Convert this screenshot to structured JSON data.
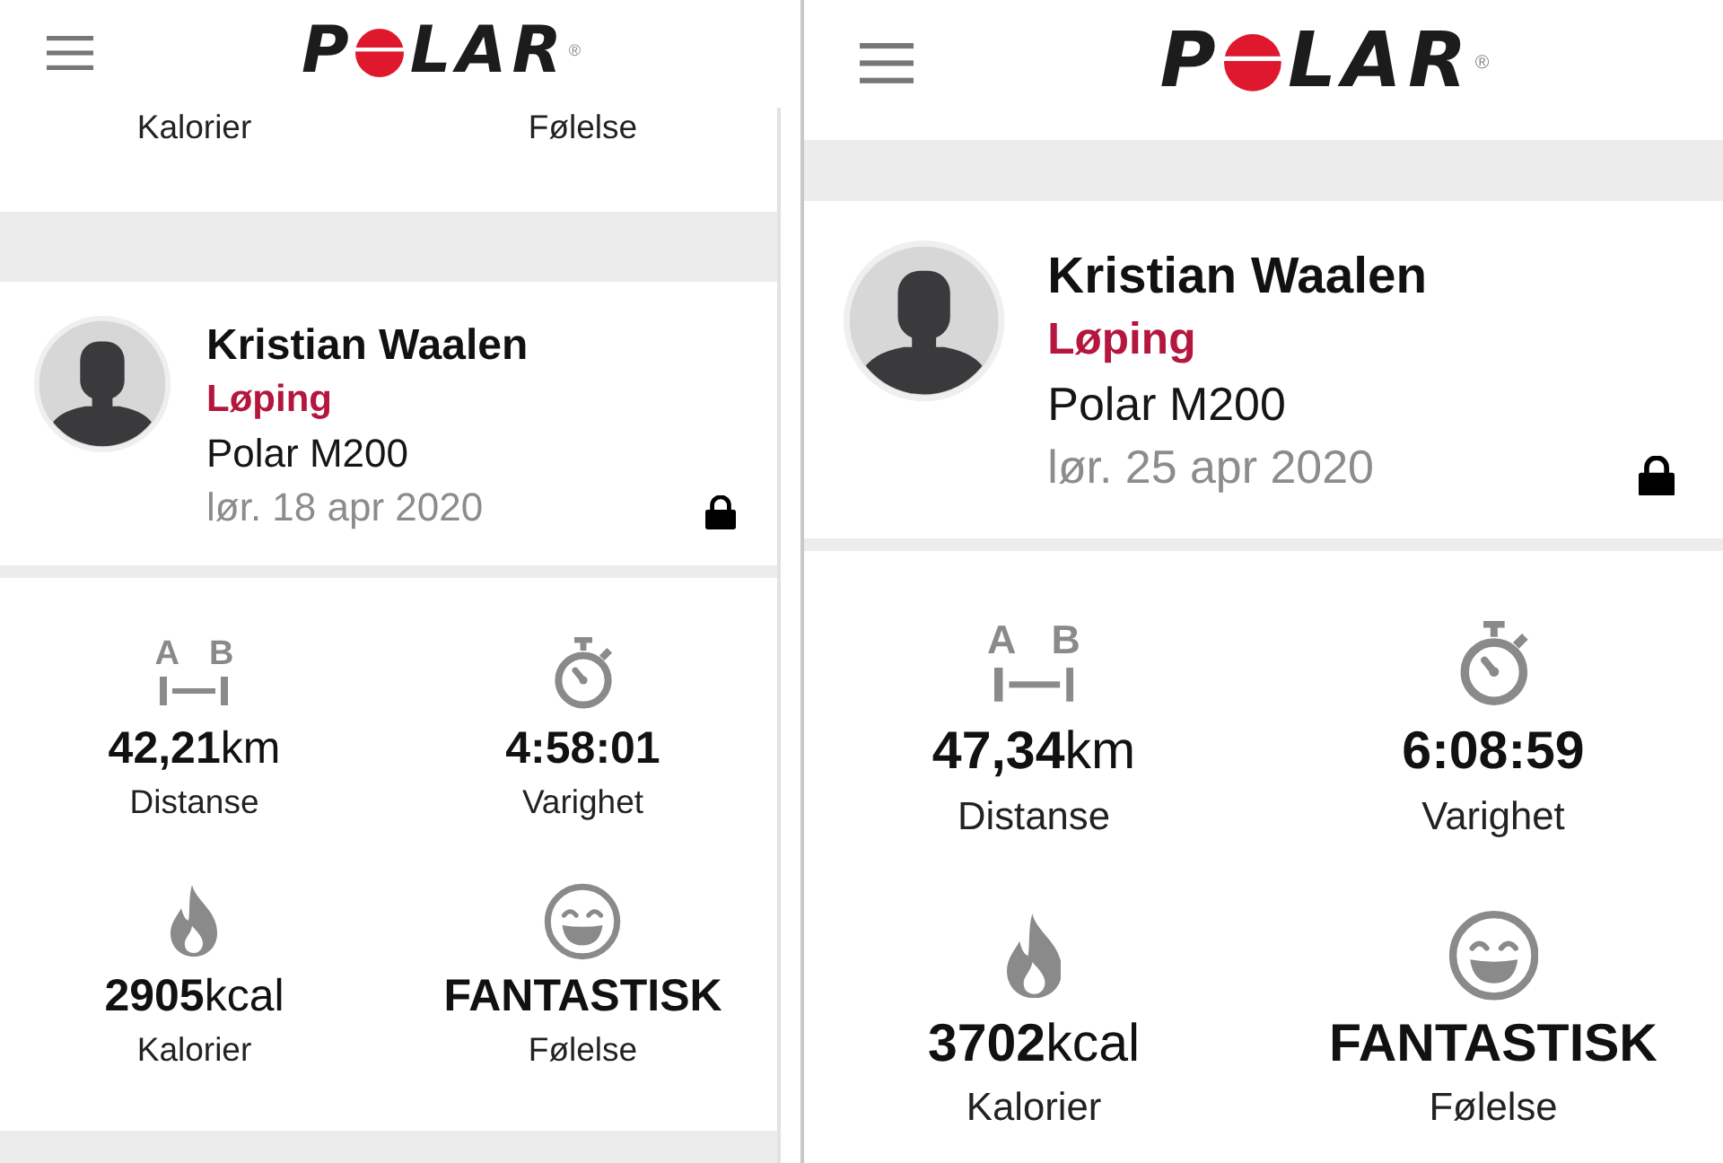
{
  "screens": [
    {
      "header": {
        "logo": {
          "start": "P",
          "end": "LAR",
          "mark": "®"
        }
      },
      "previous_card": {
        "labels": [
          "Kalorier",
          "Følelse"
        ]
      },
      "workout": {
        "name": "Kristian Waalen",
        "sport": "Løping",
        "device": "Polar M200",
        "date": "lør. 18 apr 2020"
      },
      "stats": [
        {
          "kind": "distance",
          "icon_labels": [
            "A",
            "B"
          ],
          "value": "42,21",
          "unit": "km",
          "label": "Distanse"
        },
        {
          "kind": "duration",
          "value": "4:58:01",
          "label": "Varighet"
        },
        {
          "kind": "calories",
          "value": "2905",
          "unit": "kcal",
          "label": "Kalorier"
        },
        {
          "kind": "feeling",
          "value": "FANTASTISK",
          "label": "Følelse"
        }
      ]
    },
    {
      "header": {
        "logo": {
          "start": "P",
          "end": "LAR",
          "mark": "®"
        }
      },
      "workout": {
        "name": "Kristian Waalen",
        "sport": "Løping",
        "device": "Polar M200",
        "date": "lør. 25 apr 2020"
      },
      "stats": [
        {
          "kind": "distance",
          "icon_labels": [
            "A",
            "B"
          ],
          "value": "47,34",
          "unit": "km",
          "label": "Distanse"
        },
        {
          "kind": "duration",
          "value": "6:08:59",
          "label": "Varighet"
        },
        {
          "kind": "calories",
          "value": "3702",
          "unit": "kcal",
          "label": "Kalorier"
        },
        {
          "kind": "feeling",
          "value": "FANTASTISK",
          "label": "Følelse"
        }
      ]
    }
  ]
}
